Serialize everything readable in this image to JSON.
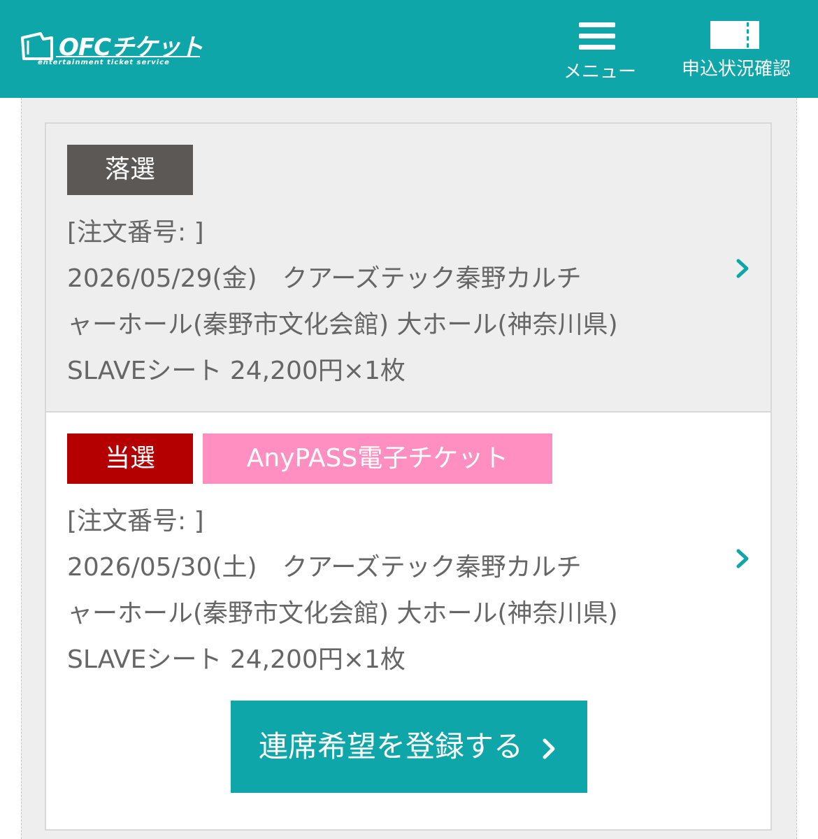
{
  "header": {
    "logo_text": "OFCチケット",
    "logo_subtext": "entertainment ticket service",
    "menu_label": "メニュー",
    "status_label": "申込状況確認",
    "accent_color": "#0fa6a9"
  },
  "orders": [
    {
      "result_badge": "落選",
      "order_number_line": "[注文番号:                                    ]",
      "date_venue_line1": "2026/05/29(金)　クアーズテック秦野カルチ",
      "date_venue_line2": "ャーホール(秦野市文化会館) 大ホール(神奈川県)",
      "seat_line": "SLAVEシート  24,200円×1枚"
    },
    {
      "result_badge": "当選",
      "ticket_type_badge": "AnyPASS電子チケット",
      "order_number_line": "[注文番号:                                    ]",
      "date_venue_line1": "2026/05/30(土)　クアーズテック秦野カルチ",
      "date_venue_line2": "ャーホール(秦野市文化会館) 大ホール(神奈川県)",
      "seat_line": "SLAVEシート  24,200円×1枚",
      "action_label": "連席希望を登録する"
    }
  ]
}
